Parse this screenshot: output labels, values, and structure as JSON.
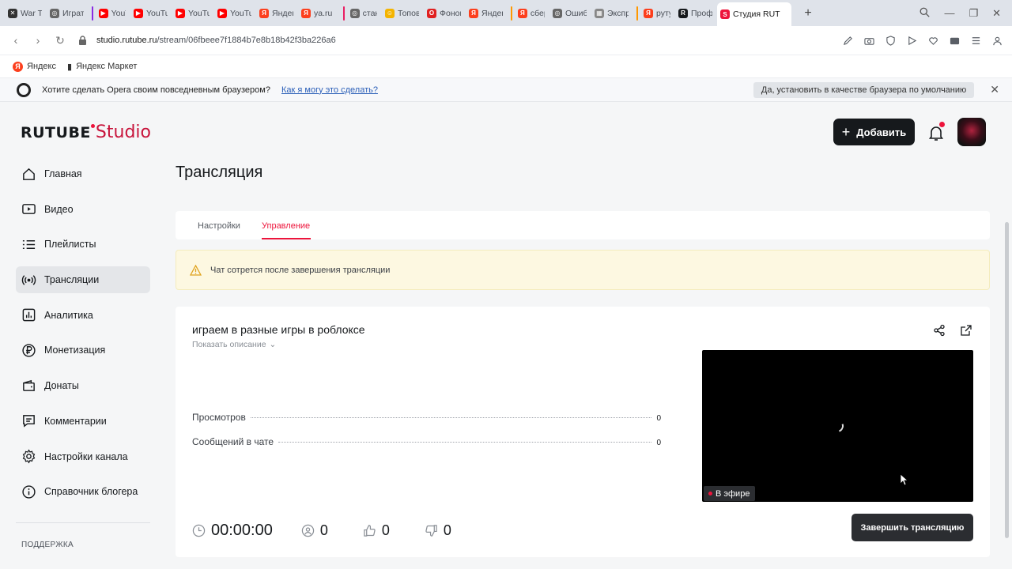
{
  "browser": {
    "tabs": [
      {
        "title": "War Th",
        "fav_color": "#333333",
        "fav": "✕",
        "stripe": ""
      },
      {
        "title": "Играть",
        "fav_color": "#666666",
        "fav": "◎",
        "stripe": ""
      },
      {
        "title": "YouTub",
        "fav_color": "#ff0000",
        "fav": "▶",
        "stripe": "#8a2be2"
      },
      {
        "title": "YouTub",
        "fav_color": "#ff0000",
        "fav": "▶",
        "stripe": ""
      },
      {
        "title": "YouTub",
        "fav_color": "#ff0000",
        "fav": "▶",
        "stripe": ""
      },
      {
        "title": "YouTub",
        "fav_color": "#ff0000",
        "fav": "▶",
        "stripe": ""
      },
      {
        "title": "Яндекс",
        "fav_color": "#fc3f1d",
        "fav": "Я",
        "stripe": ""
      },
      {
        "title": "ya.ru",
        "fav_color": "#fc3f1d",
        "fav": "Я",
        "stripe": ""
      },
      {
        "title": "станда",
        "fav_color": "#666666",
        "fav": "◎",
        "stripe": "#e91e63"
      },
      {
        "title": "Топов",
        "fav_color": "#f4b400",
        "fav": "☺",
        "stripe": ""
      },
      {
        "title": "Фоновы",
        "fav_color": "#e02020",
        "fav": "O",
        "stripe": ""
      },
      {
        "title": "Яндекс",
        "fav_color": "#fc3f1d",
        "fav": "Я",
        "stripe": ""
      },
      {
        "title": "сберб",
        "fav_color": "#fc3f1d",
        "fav": "Я",
        "stripe": "#ff9800"
      },
      {
        "title": "Ошибк",
        "fav_color": "#666666",
        "fav": "◎",
        "stripe": ""
      },
      {
        "title": "Экспр",
        "fav_color": "#888888",
        "fav": "▦",
        "stripe": ""
      },
      {
        "title": "рутуб",
        "fav_color": "#fc3f1d",
        "fav": "Я",
        "stripe": "#ff9800"
      },
      {
        "title": "Профи",
        "fav_color": "#16191c",
        "fav": "R",
        "stripe": ""
      },
      {
        "title": "Студия RUT",
        "fav_color": "#ed143b",
        "fav": "S",
        "stripe": "",
        "active": true
      }
    ],
    "url_host": "studio.rutube.ru",
    "url_path": "/stream/06fbeee7f1884b7e8b18b42f3ba226a6",
    "bookmarks": [
      "Яндекс",
      "Яндекс Маркет"
    ],
    "infobar": {
      "text": "Хотите сделать Opera своим повседневным браузером?",
      "link": "Как я могу это сделать?",
      "button": "Да, установить в качестве браузера по умолчанию"
    }
  },
  "logo": {
    "brand": "RUTUBE",
    "suffix": "Studio"
  },
  "header": {
    "add_label": "Добавить"
  },
  "sidebar": {
    "items": [
      {
        "label": "Главная",
        "icon": "home-icon"
      },
      {
        "label": "Видео",
        "icon": "video-icon"
      },
      {
        "label": "Плейлисты",
        "icon": "playlist-icon"
      },
      {
        "label": "Трансляции",
        "icon": "broadcast-icon",
        "active": true
      },
      {
        "label": "Аналитика",
        "icon": "analytics-icon"
      },
      {
        "label": "Монетизация",
        "icon": "ruble-icon"
      },
      {
        "label": "Донаты",
        "icon": "wallet-icon"
      },
      {
        "label": "Комментарии",
        "icon": "comment-icon"
      },
      {
        "label": "Настройки канала",
        "icon": "gear-icon"
      },
      {
        "label": "Справочник блогера",
        "icon": "info-icon"
      }
    ],
    "section_label": "ПОДДЕРЖКА"
  },
  "page": {
    "title": "Трансляция",
    "tabs": [
      {
        "label": "Настройки",
        "active": false
      },
      {
        "label": "Управление",
        "active": true
      }
    ],
    "warning": "Чат сотрется после завершения трансляции",
    "stream": {
      "title": "играем в разные игры в роблоксе",
      "show_description": "Показать описание",
      "stats": [
        {
          "label": "Просмотров",
          "value": "0"
        },
        {
          "label": "Сообщений в чате",
          "value": "0"
        }
      ],
      "live_label": "В эфире",
      "timer": "00:00:00",
      "viewers": "0",
      "likes": "0",
      "dislikes": "0",
      "end_button": "Завершить трансляцию"
    }
  },
  "colors": {
    "accent": "#ed143b",
    "dark": "#16191c",
    "warning_bg": "#fdf8e1"
  }
}
